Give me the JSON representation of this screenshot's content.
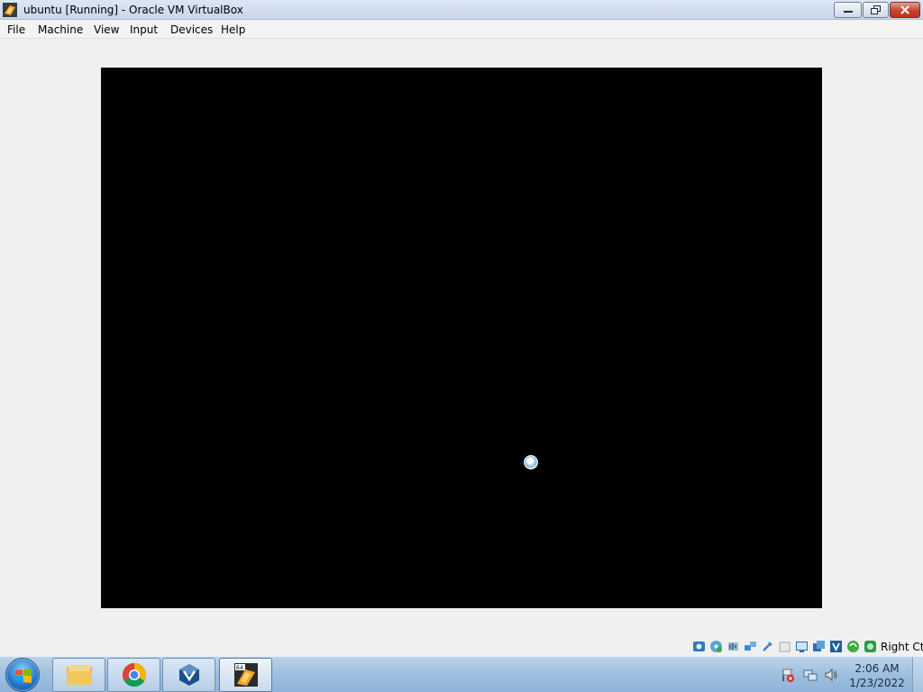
{
  "window": {
    "title": "ubuntu [Running] - Oracle VM VirtualBox",
    "controls": {
      "minimize": "minimize-icon",
      "maximize": "restore-icon",
      "close": "close-icon"
    }
  },
  "menu": [
    "File",
    "Machine",
    "View",
    "Input",
    "Devices",
    "Help"
  ],
  "vm": {
    "screen_color": "#000000",
    "cursor": "busy-cursor-icon"
  },
  "status_bar": {
    "icons": [
      "hard-disk-icon",
      "optical-drive-icon",
      "audio-icon",
      "network-icon",
      "usb-icon",
      "shared-folders-icon",
      "display-icon",
      "video-capture-icon",
      "guest-additions-icon",
      "virtualization-icon",
      "mouse-integration-icon",
      "keyboard-capture-icon"
    ],
    "host_key": "Right Ctrl"
  },
  "taskbar": {
    "start": "windows-logo-icon",
    "items": [
      {
        "icon": "file-explorer-icon",
        "active": false
      },
      {
        "icon": "chrome-icon",
        "active": false
      },
      {
        "icon": "virtualbox-icon",
        "active": false
      },
      {
        "icon": "virtualbox-vm-64-icon",
        "active": true
      }
    ],
    "tray": {
      "icons": [
        "action-center-flag-icon",
        "network-tray-icon",
        "volume-icon"
      ],
      "time": "2:06 AM",
      "date": "1/23/2022"
    }
  },
  "colors": {
    "titlebar": "#c9d7eb",
    "window_bg": "#f0f0f0",
    "close_button": "#c8422c",
    "taskbar": "#9ebfdf"
  }
}
